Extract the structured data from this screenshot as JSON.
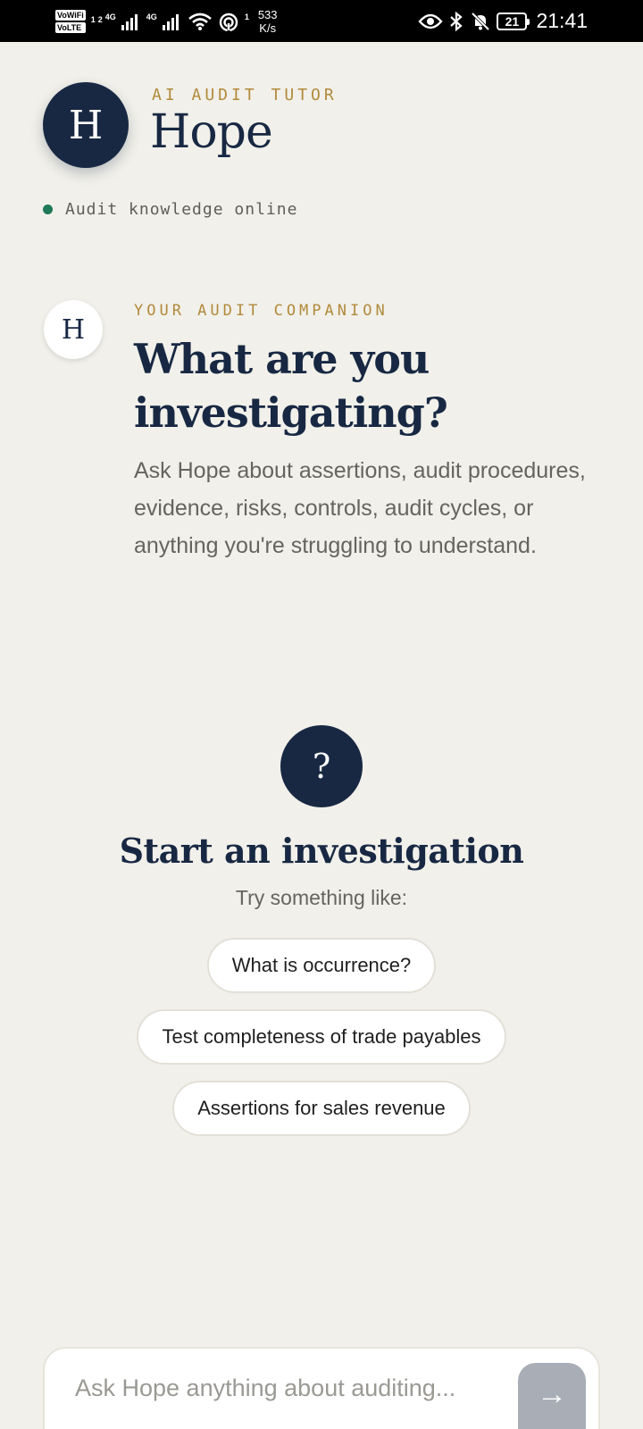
{
  "status_bar": {
    "vowifi": "VoWiFi",
    "volte": "VoLTE",
    "sim1": "1",
    "sim2": "2",
    "net1": "4G",
    "net2": "4G",
    "hotspot_count": "1",
    "speed_value": "533",
    "speed_unit": "K/s",
    "battery": "21",
    "time": "21:41"
  },
  "header": {
    "avatar_letter": "H",
    "kicker": "AI AUDIT TUTOR",
    "title": "Hope",
    "status_text": "Audit knowledge online",
    "status_color": "#1f7a5a"
  },
  "intro": {
    "avatar_letter": "H",
    "kicker": "YOUR AUDIT COMPANION",
    "title": "What are you investigating?",
    "body": "Ask Hope about assertions, audit procedures, evidence, risks, controls, audit cycles, or anything you're struggling to understand."
  },
  "empty_state": {
    "icon_glyph": "?",
    "title": "Start an investigation",
    "subtitle": "Try something like:",
    "suggestions": [
      "What is occurrence?",
      "Test completeness of trade payables",
      "Assertions for sales revenue"
    ]
  },
  "composer": {
    "placeholder": "Ask Hope anything about auditing...",
    "value": "",
    "send_glyph": "→"
  },
  "colors": {
    "navy": "#182843",
    "gold": "#b28a3c",
    "background": "#f1f0ea",
    "send_disabled": "#a8adb6"
  }
}
